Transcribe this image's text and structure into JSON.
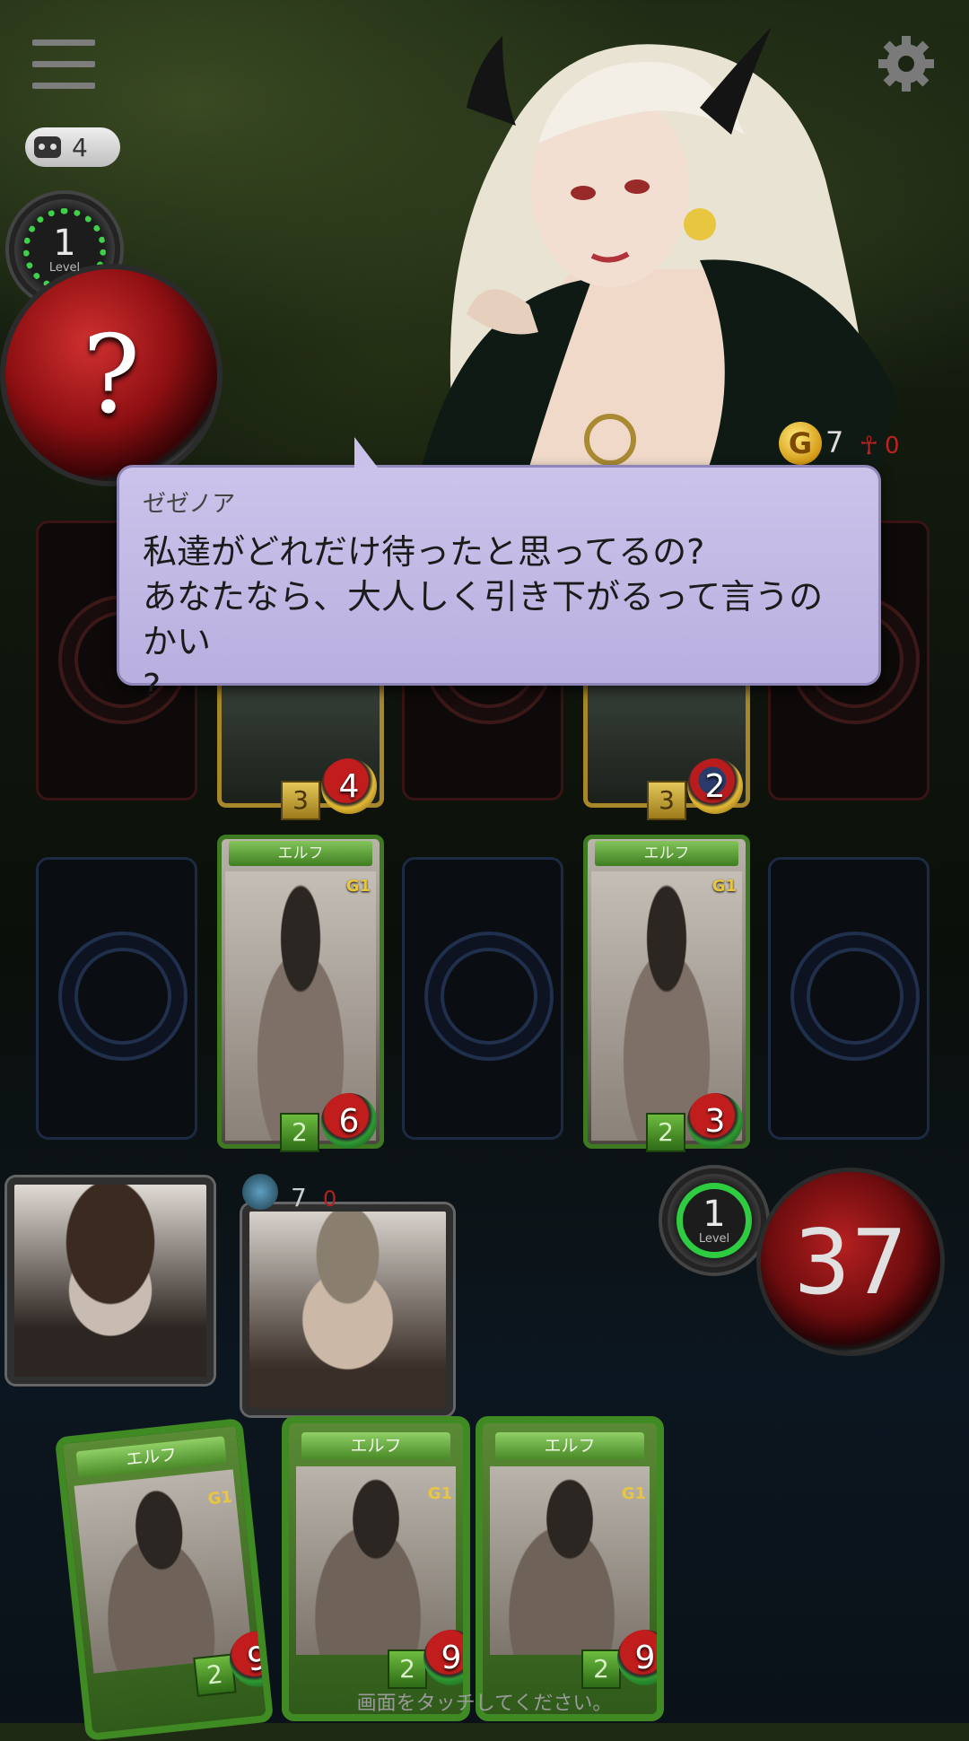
{
  "top_bar": {
    "menu_icon": "hamburger-menu-icon",
    "settings_icon": "gear-icon",
    "deck_count": "4"
  },
  "enemy": {
    "level": "1",
    "level_label": "Level",
    "life": "?",
    "gold": "7",
    "red_count": "0"
  },
  "dialog": {
    "speaker": "ゼゼノア",
    "line1": "私達がどれだけ待ったと思ってるの?",
    "line2": "あなたなら、大人しく引き下がるって言うのかい",
    "line3": "?"
  },
  "enemy_field": [
    {
      "cost": "3",
      "hp": "4"
    },
    {
      "cost": "3",
      "hp": "2"
    }
  ],
  "player_field": [
    {
      "race": "エルフ",
      "grade": "G1",
      "cost": "2",
      "hp": "6"
    },
    {
      "race": "エルフ",
      "grade": "G1",
      "cost": "2",
      "hp": "3"
    }
  ],
  "player": {
    "level": "1",
    "level_label": "Level",
    "life": "37",
    "mini_gold": "7",
    "mini_red": "0"
  },
  "hand": [
    {
      "race": "エルフ",
      "grade": "G1",
      "cost": "2",
      "hp": "9"
    },
    {
      "race": "エルフ",
      "grade": "G1",
      "cost": "2",
      "hp": "9"
    },
    {
      "race": "エルフ",
      "grade": "G1",
      "cost": "2",
      "hp": "9"
    }
  ],
  "hint": "画面をタッチしてください。"
}
